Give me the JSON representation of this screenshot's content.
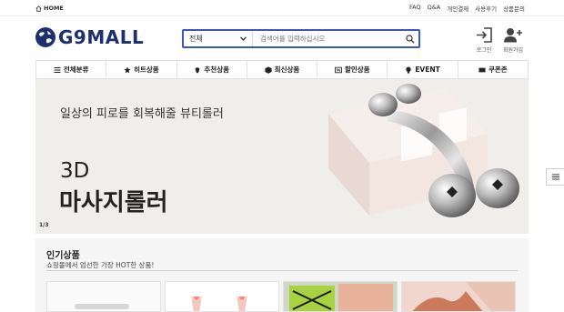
{
  "topbar": {
    "home_label": "HOME",
    "links": [
      "FAQ",
      "Q&A",
      "개인결제",
      "사용후기",
      "상품문의"
    ]
  },
  "header": {
    "logo_text": "G9MALL",
    "search": {
      "category": "전체",
      "placeholder": "검색어를 입력하십시오"
    },
    "login_label": "로그인",
    "join_label": "회원가입"
  },
  "nav": {
    "items": [
      {
        "label": "전체분류",
        "icon": "menu-icon"
      },
      {
        "label": "히트상품",
        "icon": "star-icon"
      },
      {
        "label": "추천상품",
        "icon": "thumb-icon"
      },
      {
        "label": "최신상품",
        "icon": "cube-icon"
      },
      {
        "label": "할인상품",
        "icon": "discount-icon"
      },
      {
        "label": "EVENT",
        "icon": "bulb-icon"
      },
      {
        "label": "쿠폰존",
        "icon": "coupon-icon"
      }
    ]
  },
  "banner": {
    "subtitle": "일상의 피로를 회복해줄 뷰티롤러",
    "title_line1": "3D",
    "title_line2": "마사지롤러",
    "counter": "1/3"
  },
  "popular": {
    "title": "인기상품",
    "subtitle": "쇼핑몰에서 엄선한 가장 HOT한 상품!"
  },
  "colors": {
    "brand": "#1e2f6f",
    "search_border": "#3a55c5",
    "banner_bg": "#f0eeeb"
  }
}
